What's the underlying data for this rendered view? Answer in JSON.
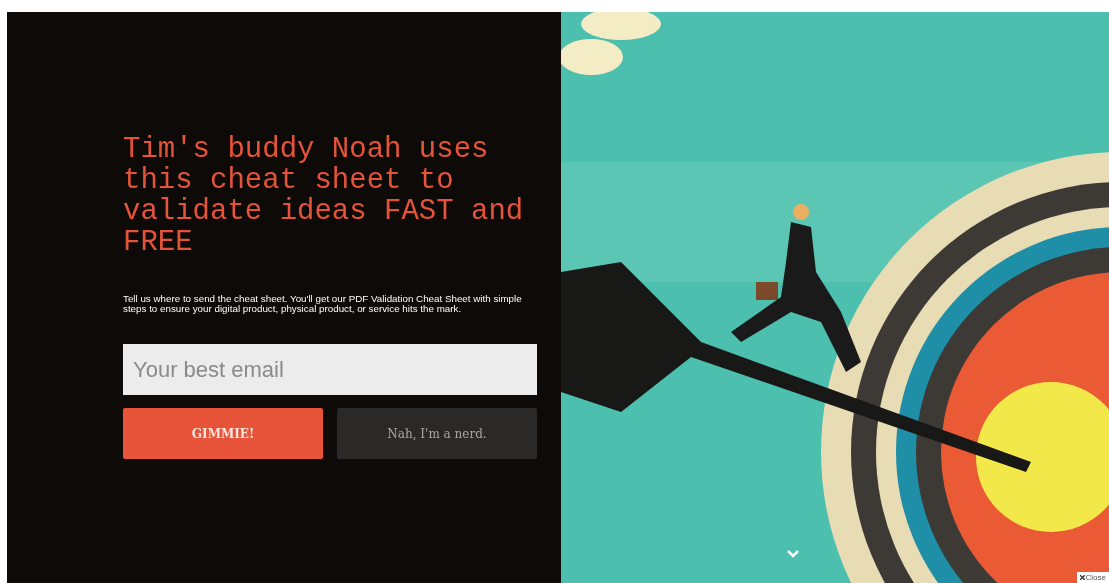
{
  "headline": "Tim's buddy Noah uses this cheat sheet to validate ideas FAST and FREE",
  "description": "Tell us where to send the cheat sheet. You'll get our PDF Validation Cheat Sheet with simple steps to ensure your digital product, physical product, or service hits the mark.",
  "email_field": {
    "placeholder": "Your best email"
  },
  "buttons": [
    {
      "label": "GIMMIE!",
      "kind": "primary"
    },
    {
      "label": "Nah, I'm a nerd.",
      "kind": "secondary"
    }
  ],
  "close_label": "Close"
}
